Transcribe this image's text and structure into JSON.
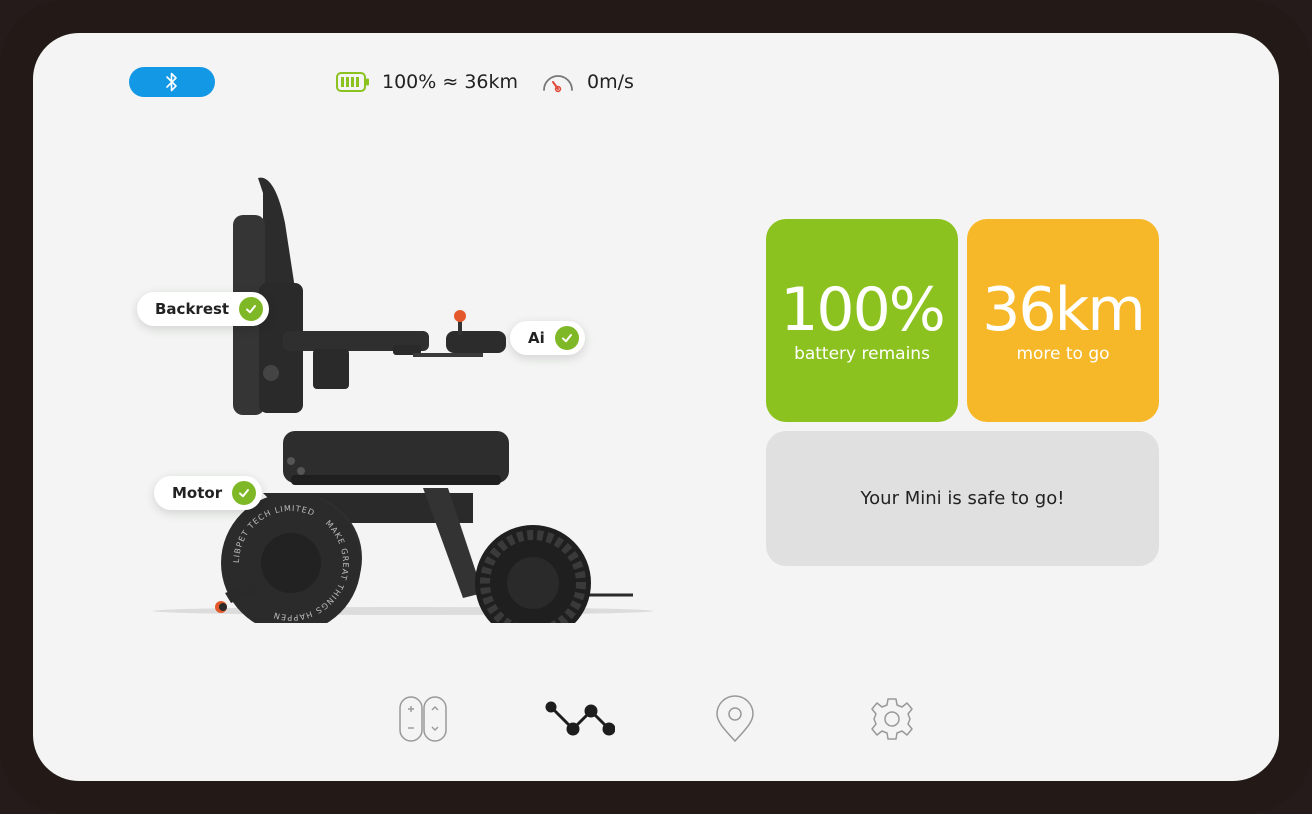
{
  "status_bar": {
    "bluetooth_icon": "bluetooth-icon",
    "battery_icon": "battery-icon",
    "battery_text": "100% ≈ 36km",
    "speed_icon": "speedometer-icon",
    "speed_text": "0m/s"
  },
  "chair_tags": [
    {
      "label": "Backrest",
      "status": "ok"
    },
    {
      "label": "Ai",
      "status": "ok"
    },
    {
      "label": "Motor",
      "status": "ok"
    }
  ],
  "wheel_text": {
    "outer": "LIBPET TECH LIMITED",
    "inner": "MAKE GREAT THINGS HAPPEN"
  },
  "cards": {
    "battery": {
      "value": "100%",
      "caption": "battery remains"
    },
    "range": {
      "value": "36km",
      "caption": "more to go"
    },
    "safety": {
      "message": "Your Mini is safe to go!"
    }
  },
  "nav": [
    {
      "name": "controls",
      "icon": "plus-minus-updown-icon"
    },
    {
      "name": "route",
      "icon": "route-icon",
      "active": true
    },
    {
      "name": "location",
      "icon": "location-pin-icon"
    },
    {
      "name": "settings",
      "icon": "gear-icon"
    }
  ],
  "colors": {
    "bluetooth": "#1398e6",
    "battery_card": "#8cc21f",
    "range_card": "#f6b829",
    "check": "#7fb826",
    "safe_card": "#dfe0df"
  }
}
